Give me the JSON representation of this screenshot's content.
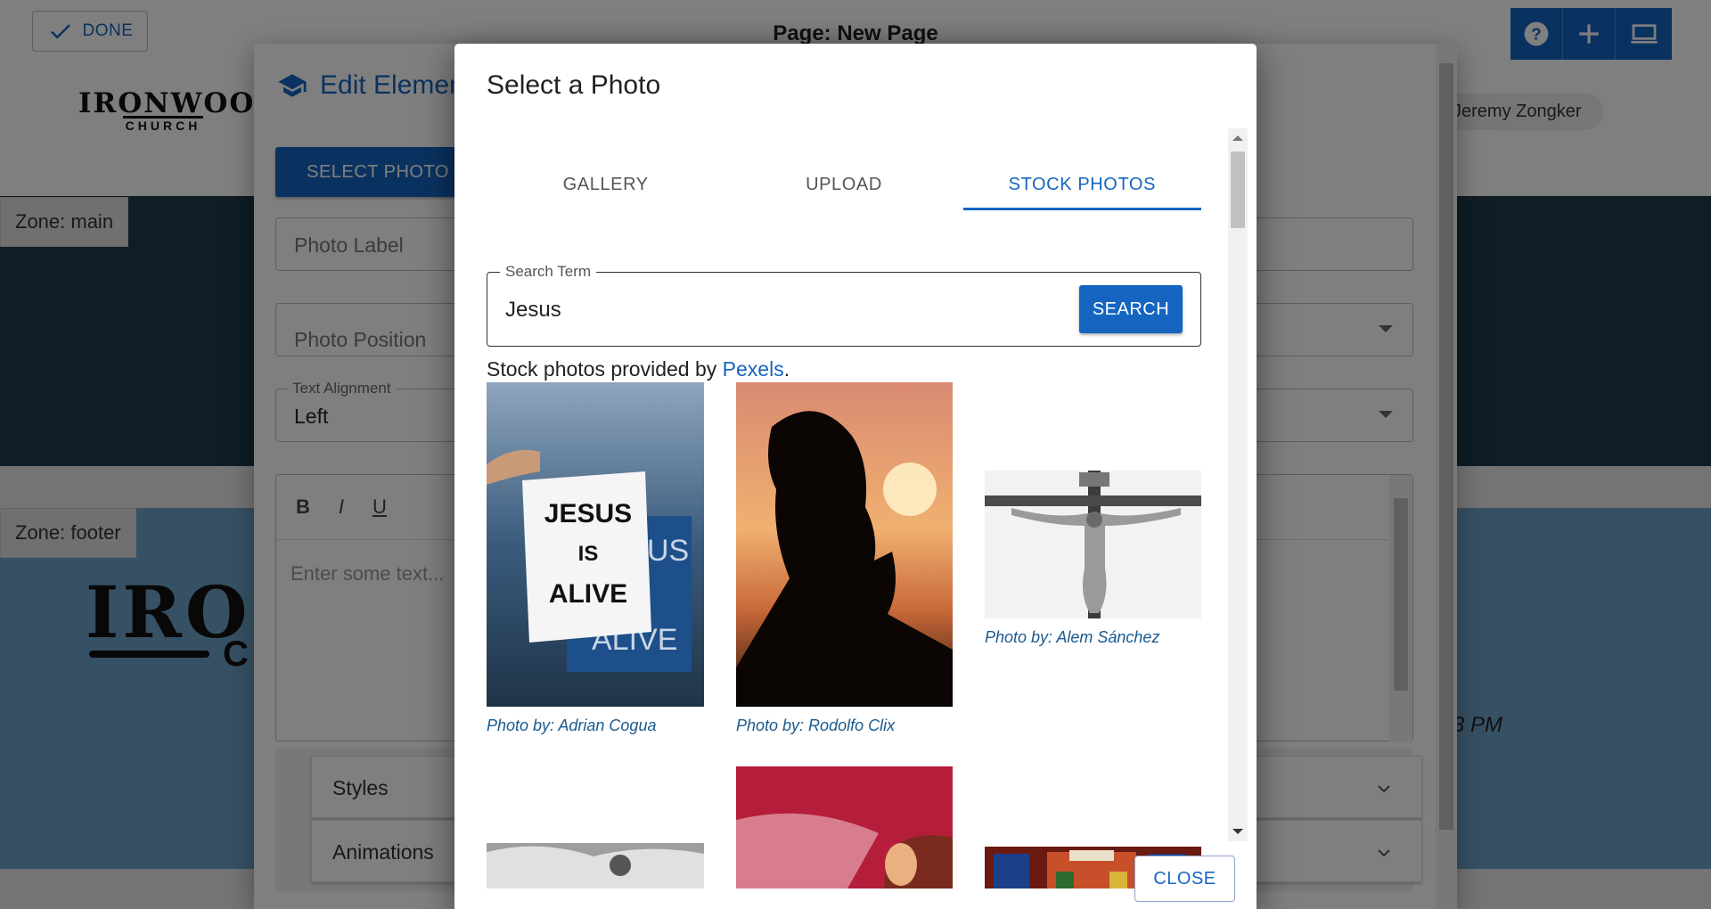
{
  "topbar": {
    "done_label": "DONE",
    "page_title": "Page: New Page",
    "icons": [
      "help-icon",
      "add-icon",
      "desktop-icon"
    ]
  },
  "site": {
    "logo_top": "IRONWOOD",
    "logo_bottom": "CHURCH",
    "user_name": "Jeremy Zongker",
    "zone_main_label": "Zone: main",
    "zone_footer_label": "Zone: footer",
    "footer_logo": "IRO",
    "footer_logo_c": "C",
    "footer_time": "3 PM"
  },
  "edit_panel": {
    "title": "Edit Element",
    "select_photo_label": "SELECT PHOTO",
    "photo_label_placeholder": "Photo Label",
    "photo_position_placeholder": "Photo Position",
    "text_alignment_legend": "Text Alignment",
    "text_alignment_value": "Left",
    "toolbar": [
      "B",
      "I",
      "U"
    ],
    "editor_placeholder": "Enter some text...",
    "styles_label": "Styles",
    "animations_label": "Animations"
  },
  "dialog": {
    "title": "Select a Photo",
    "tabs": [
      "GALLERY",
      "UPLOAD",
      "STOCK PHOTOS"
    ],
    "active_tab": "STOCK PHOTOS",
    "search": {
      "legend": "Search Term",
      "value": "Jesus",
      "button_label": "SEARCH"
    },
    "provided_prefix": "Stock photos provided by ",
    "provided_link": "Pexels",
    "provided_suffix": ".",
    "photos": [
      {
        "credit": "Photo by: Adrian Cogua",
        "sign_lines": [
          "JESUS",
          "IS",
          "ALIVE"
        ]
      },
      {
        "credit": "Photo by: Rodolfo Clix"
      },
      {
        "credit": "Photo by: Alem Sánchez"
      }
    ],
    "close_label": "CLOSE"
  },
  "colors": {
    "primary": "#1565c0",
    "zone_main_bg": "#1f3a4d",
    "zone_footer_bg": "#6da3c9"
  }
}
